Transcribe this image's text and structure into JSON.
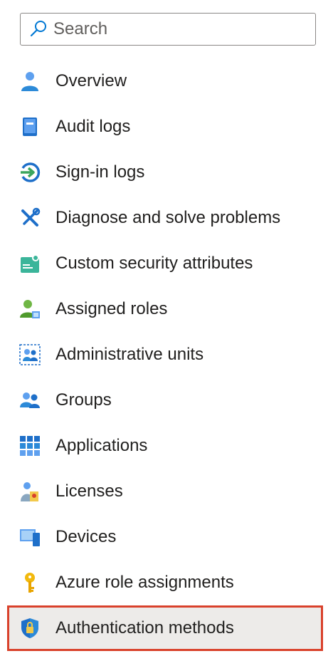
{
  "search": {
    "placeholder": "Search",
    "value": ""
  },
  "nav": {
    "items": [
      {
        "label": "Overview",
        "icon": "user-icon"
      },
      {
        "label": "Audit logs",
        "icon": "book-icon"
      },
      {
        "label": "Sign-in logs",
        "icon": "sign-in-icon"
      },
      {
        "label": "Diagnose and solve problems",
        "icon": "wrench-screwdriver-icon"
      },
      {
        "label": "Custom security attributes",
        "icon": "security-attributes-icon"
      },
      {
        "label": "Assigned roles",
        "icon": "assigned-roles-icon"
      },
      {
        "label": "Administrative units",
        "icon": "administrative-units-icon"
      },
      {
        "label": "Groups",
        "icon": "groups-icon"
      },
      {
        "label": "Applications",
        "icon": "grid-icon"
      },
      {
        "label": "Licenses",
        "icon": "license-icon"
      },
      {
        "label": "Devices",
        "icon": "devices-icon"
      },
      {
        "label": "Azure role assignments",
        "icon": "key-icon"
      },
      {
        "label": "Authentication methods",
        "icon": "shield-lock-icon",
        "selected": true
      }
    ]
  },
  "colors": {
    "selection_border": "#d9412b",
    "selection_bg": "#edebe9",
    "accent": "#0078d4"
  }
}
